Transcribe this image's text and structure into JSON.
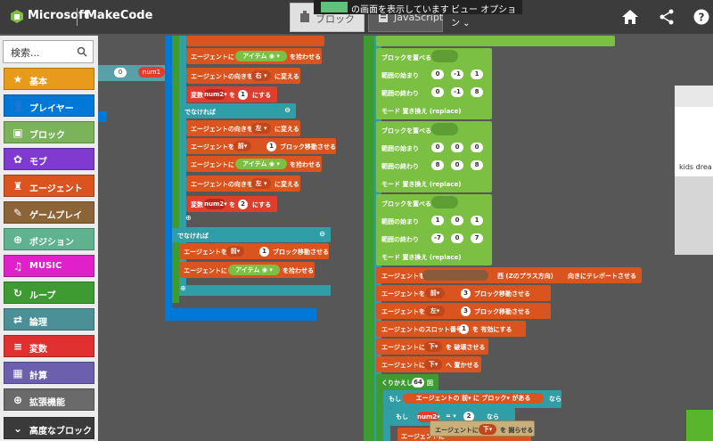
{
  "header": {
    "brand": "Microsoft",
    "app": "MakeCode",
    "tab_blocks": "ブロック",
    "tab_js": "JavaScript",
    "share_text": "の画面を表示しています",
    "share_option": "ビュー オプション"
  },
  "toolbox": {
    "search_placeholder": "検索...",
    "categories": [
      {
        "label": "基本",
        "color": "#e89a1a",
        "icon": "star-icon"
      },
      {
        "label": "プレイヤー",
        "color": "#0078d7",
        "icon": "person-icon"
      },
      {
        "label": "ブロック",
        "color": "#7bb35b",
        "icon": "cube-icon"
      },
      {
        "label": "モブ",
        "color": "#7f3bcf",
        "icon": "paw-icon"
      },
      {
        "label": "エージェント",
        "color": "#d9541e",
        "icon": "agent-icon"
      },
      {
        "label": "ゲームプレイ",
        "color": "#8b6437",
        "icon": "wrench-icon"
      },
      {
        "label": "ポジション",
        "color": "#5fb28e",
        "icon": "crosshair-icon"
      },
      {
        "label": "MUSIC",
        "color": "#e020c8",
        "icon": "headphones-icon"
      },
      {
        "label": "ループ",
        "color": "#3d9b32",
        "icon": "loop-icon"
      },
      {
        "label": "論理",
        "color": "#4b8f97",
        "icon": "shuffle-icon"
      },
      {
        "label": "変数",
        "color": "#e0302f",
        "icon": "list-icon"
      },
      {
        "label": "計算",
        "color": "#6b5fae",
        "icon": "calculator-icon"
      },
      {
        "label": "拡張機能",
        "color": "#6a6a6a",
        "icon": "plus-circle-icon"
      },
      {
        "label": "高度なブロック",
        "color": "#3a3a3a",
        "icon": "chevron-down-icon"
      }
    ]
  },
  "workspace": {
    "left": {
      "num1": "num1",
      "zero": "0"
    },
    "mid": {
      "lines": [
        "エージェントに",
        "アイテム",
        "を拾わせる",
        "エージェントの向きを",
        "右",
        "に変える",
        "変数",
        "num2",
        "を",
        "1",
        "にする",
        "でなければ",
        "左",
        "前",
        "ブロック移動させる",
        "2",
        "エージェントを"
      ]
    },
    "right": {
      "place_block": "ブロックを置べる",
      "range_start": "範囲の始まり",
      "range_end": "範囲の終わり",
      "mode": "モード",
      "replace": "置き換え (replace)",
      "teleport": "エージェントを",
      "teleport_dir": "西 (Zのプラス方向)",
      "teleport_tail": "向きにテレポートさせる",
      "move_fwd": "ブロック移動させる",
      "slot": "エージェントのスロット番号",
      "slot_tail": "を 有効にする",
      "build_down": "を 破壊させる",
      "place_down": "へ 置かせる",
      "repeat": "くりかえし",
      "repeat_count": "64",
      "repeat_tail": "回",
      "if_label": "もし",
      "agent_detect": "エージェントの",
      "block": "ブロック",
      "exists": "がある",
      "then": "なら",
      "eq": "= ▾",
      "two": "2",
      "down": "下",
      "dig": "を 掘らせる",
      "agent_dig": "エージェントに",
      "neg1": "-1",
      "zero": "0",
      "one": "1",
      "eight": "8",
      "neg7": "-7",
      "seven": "7",
      "fwd": "前",
      "left": "左",
      "three": "3",
      "slot_one": "1"
    },
    "video_label": "kids drea"
  }
}
